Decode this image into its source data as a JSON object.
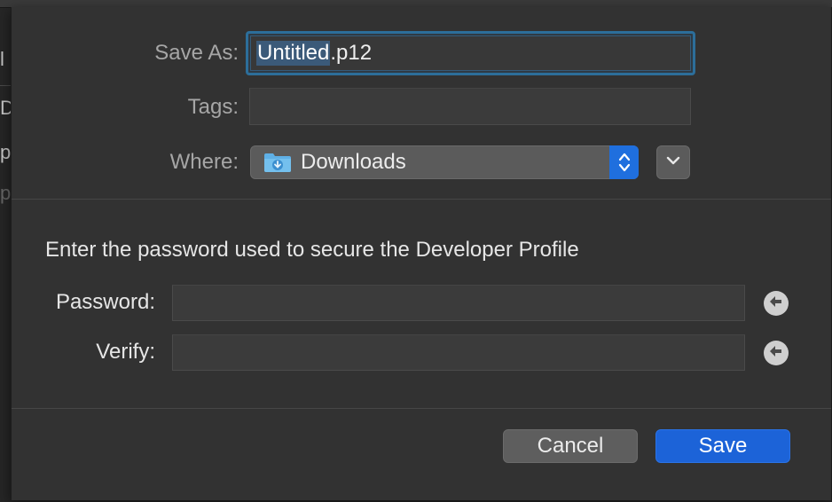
{
  "background": {
    "fragments": [
      "l",
      "D",
      "p",
      "p"
    ]
  },
  "dialog": {
    "save_as_label": "Save As:",
    "filename_base": "Untitled",
    "filename_ext": ".p12",
    "tags_label": "Tags:",
    "tags_value": "",
    "where_label": "Where:",
    "where_value": "Downloads",
    "where_icon": "downloads-folder-icon"
  },
  "password_section": {
    "prompt": "Enter the password used to secure the Developer Profile",
    "password_label": "Password:",
    "password_value": "",
    "verify_label": "Verify:",
    "verify_value": ""
  },
  "buttons": {
    "cancel": "Cancel",
    "save": "Save"
  },
  "colors": {
    "accent": "#1c63d8",
    "focus_ring": "#2c6e9a",
    "sheet_bg": "#323232"
  }
}
